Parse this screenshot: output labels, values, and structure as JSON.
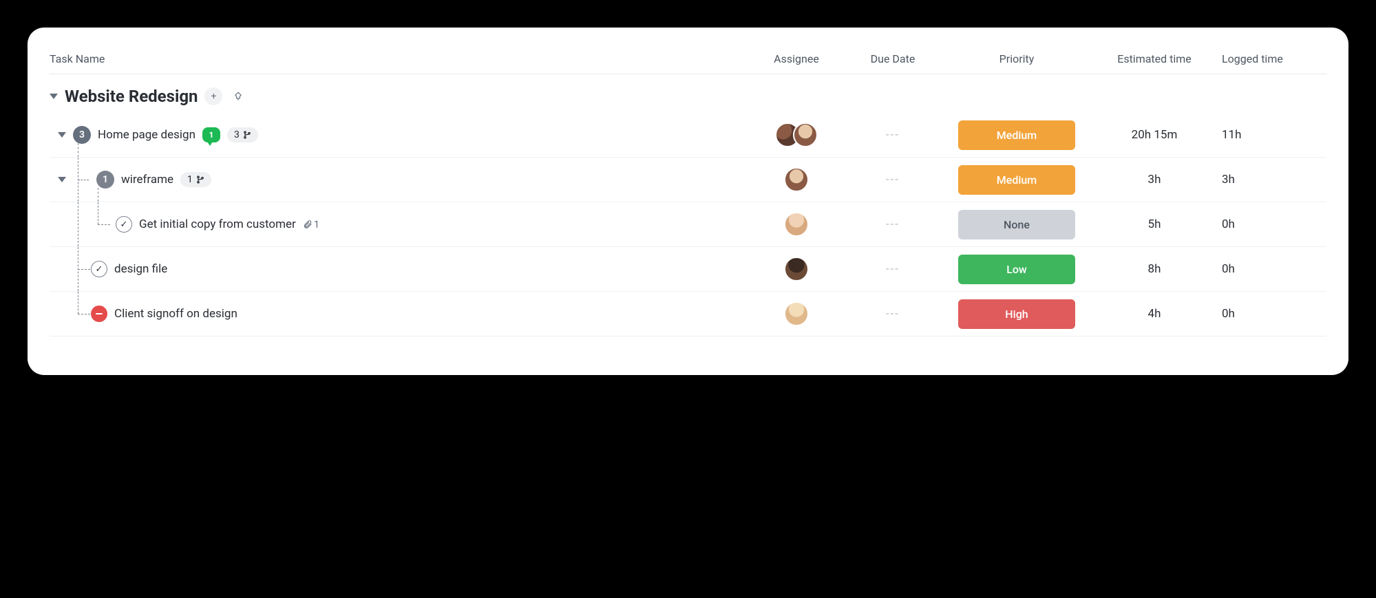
{
  "columns": {
    "task_name": "Task Name",
    "assignee": "Assignee",
    "due_date": "Due Date",
    "priority": "Priority",
    "estimated": "Estimated time",
    "logged": "Logged time"
  },
  "group": {
    "title": "Website Redesign"
  },
  "tasks": [
    {
      "name": "Home page design",
      "count": "3",
      "comments": "1",
      "branch": "3",
      "due": "---",
      "priority_label": "Medium",
      "priority_key": "medium",
      "estimated": "20h 15m",
      "logged": "11h"
    },
    {
      "name": "wireframe",
      "count": "1",
      "branch": "1",
      "due": "---",
      "priority_label": "Medium",
      "priority_key": "medium",
      "estimated": "3h",
      "logged": "3h"
    },
    {
      "name": "Get initial copy from customer",
      "attachments": "1",
      "due": "---",
      "priority_label": "None",
      "priority_key": "none",
      "estimated": "5h",
      "logged": "0h"
    },
    {
      "name": "design file",
      "due": "---",
      "priority_label": "Low",
      "priority_key": "low",
      "estimated": "8h",
      "logged": "0h"
    },
    {
      "name": "Client signoff on design",
      "due": "---",
      "priority_label": "High",
      "priority_key": "high",
      "estimated": "4h",
      "logged": "0h"
    }
  ]
}
